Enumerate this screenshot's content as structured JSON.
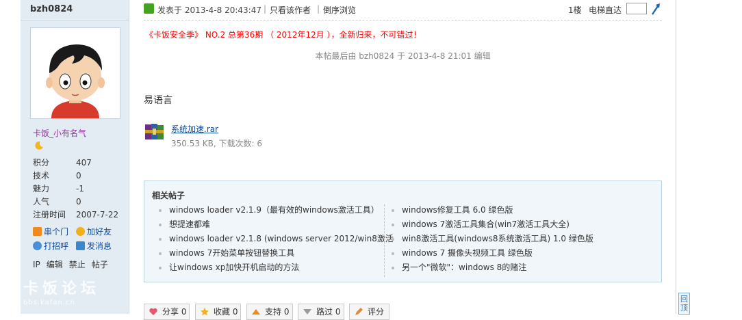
{
  "user": {
    "name": "bzh0824",
    "group": "卡饭_小有名气",
    "stats": [
      {
        "label": "积分",
        "value": "407"
      },
      {
        "label": "技术",
        "value": "0"
      },
      {
        "label": "魅力",
        "value": "-1"
      },
      {
        "label": "人气",
        "value": "0"
      },
      {
        "label": "注册时间",
        "value": "2007-7-22"
      }
    ],
    "actions": {
      "pm": "串个门",
      "addfriend": "加好友",
      "poke": "打招呼",
      "message": "发消息"
    },
    "admin_links": [
      "IP",
      "编辑",
      "禁止",
      "帖子"
    ]
  },
  "watermark": {
    "big": "卡饭论坛",
    "small": "bbs.kafan.cn"
  },
  "post": {
    "posted_at": "发表于 2013-4-8 20:43:47",
    "separator": "|",
    "only_author": "只看该作者",
    "reverse_order": "倒序浏览",
    "floor": "1楼",
    "jump_label": "电梯直达",
    "jump_value": "",
    "promo": "《卡饭安全季》 NO.2 总第36期 （ 2012年12月 ），全新归来，不可错过！",
    "edit_note": "本帖最后由 bzh0824 于 2013-4-8 21:01 编辑",
    "body": "易语言",
    "attachment": {
      "name": "系统加速.rar",
      "meta": "350.53 KB, 下载次数: 6"
    }
  },
  "related": {
    "title": "相关帖子",
    "left": [
      "windows loader v2.1.9（最有效的windows激活工具）",
      "想提速都难",
      "windows loader v2.1.8 (windows server 2012/win8激活",
      "windows 7开始菜单按钮替换工具",
      "让windows xp加快开机启动的方法"
    ],
    "right": [
      "windows修复工具 6.0 绿色版",
      "windows 7激活工具集合(win7激活工具大全)",
      "win8激活工具(windows8系统激活工具) 1.0 绿色版",
      "windows 7 摄像头视频工具 绿色版",
      "另一个\"微软\"：windows 8的赌注"
    ]
  },
  "buttons": [
    {
      "label": "分享 0",
      "icon": "heart-icon"
    },
    {
      "label": "收藏 0",
      "icon": "star-icon"
    },
    {
      "label": "支持 0",
      "icon": "thumbs-up-icon"
    },
    {
      "label": "路过 0",
      "icon": "thumbs-down-icon"
    },
    {
      "label": "评分",
      "icon": "rate-icon"
    }
  ],
  "back_to_top": "回顶",
  "colors": {
    "sidebar_bg": "#e4ecf3",
    "link": "#0d4d9c",
    "promo": "#ff0000",
    "usergroup": "#9b2fa6",
    "related_bg": "#f1f6fa"
  }
}
